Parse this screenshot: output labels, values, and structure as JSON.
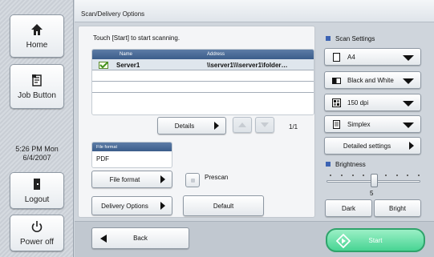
{
  "rail": {
    "home_label": "Home",
    "job_label": "Job Button",
    "time": "5:26 PM  Mon",
    "date": "6/4/2007",
    "logout_label": "Logout",
    "power_label": "Power off"
  },
  "header": {
    "title": "Scan/Delivery Options"
  },
  "main": {
    "hint": "Touch [Start] to start scanning.",
    "list": {
      "col_name": "Name",
      "col_address": "Address",
      "rows": [
        {
          "name": "Server1",
          "address": "\\\\server1\\\\\\server1\\folder…",
          "checked": true
        }
      ]
    },
    "details_label": "Details",
    "pager": "1/1",
    "file_format_header": "File format",
    "file_format_value": "PDF",
    "file_format_button": "File format",
    "prescan_label": "Prescan",
    "delivery_options_button": "Delivery Options",
    "default_button": "Default"
  },
  "settings": {
    "title": "Scan Settings",
    "paper": "A4",
    "color": "Black and White",
    "resolution": "150 dpi",
    "sides": "Simplex",
    "detailed_button": "Detailed settings"
  },
  "brightness": {
    "title": "Brightness",
    "value": "5",
    "level_fraction": 0.5,
    "dark_label": "Dark",
    "bright_label": "Bright"
  },
  "bottom": {
    "back_label": "Back",
    "start_label": "Start"
  },
  "colors": {
    "accent": "#3c63b3",
    "start_green": "#48d493",
    "header_blue": "#3b5d8a"
  }
}
